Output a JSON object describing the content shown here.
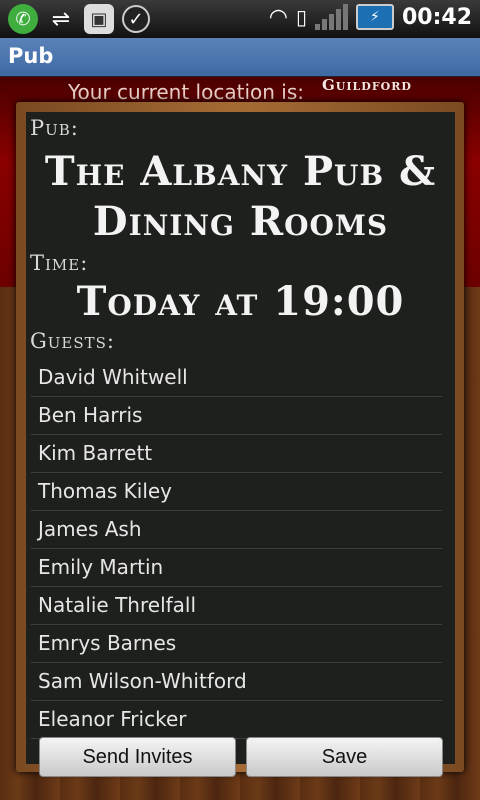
{
  "status_bar": {
    "time": "00:42",
    "icons": [
      "phone-icon",
      "usb-icon",
      "android-debug-icon",
      "check-icon",
      "wifi-icon",
      "vibrate-icon",
      "signal-icon",
      "battery-charging-icon"
    ]
  },
  "app": {
    "title": "Pub"
  },
  "location": {
    "label": "Your current location is:",
    "value": "Guildford"
  },
  "board": {
    "pub_label": "Pub:",
    "pub_name_line1": "The Albany Pub &",
    "pub_name_line2": "Dining Rooms",
    "time_label": "Time:",
    "time_value": "Today at 19:00",
    "guests_label": "Guests:",
    "guests": [
      "David Whitwell",
      "Ben Harris",
      "Kim Barrett",
      "Thomas Kiley",
      "James Ash",
      "Emily Martin",
      "Natalie Threlfall",
      "Emrys Barnes",
      "Sam Wilson-Whitford",
      "Eleanor Fricker"
    ]
  },
  "actions": {
    "send_invites": "Send Invites",
    "save": "Save"
  }
}
